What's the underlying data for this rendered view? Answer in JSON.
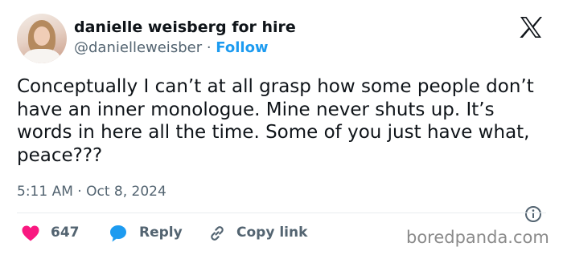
{
  "author": {
    "display_name": "danielle weisberg for hire",
    "handle": "@danielleweisber",
    "separator": "·",
    "follow_label": "Follow"
  },
  "tweet": {
    "text": "Conceptually I can’t at all grasp how some people don’t have an inner monologue. Mine never shuts up. It’s words in here all the time. Some of you just have what, peace???",
    "timestamp": "5:11 AM · Oct 8, 2024"
  },
  "actions": {
    "like_count": "647",
    "reply_label": "Reply",
    "copy_link_label": "Copy link"
  },
  "watermark": "boredpanda.com",
  "colors": {
    "accent": "#1d9bf0",
    "heart": "#f91880",
    "text": "#0f1419",
    "muted": "#536471"
  },
  "icons": [
    "x-logo-icon",
    "info-icon",
    "heart-icon",
    "reply-bubble-icon",
    "link-icon"
  ]
}
